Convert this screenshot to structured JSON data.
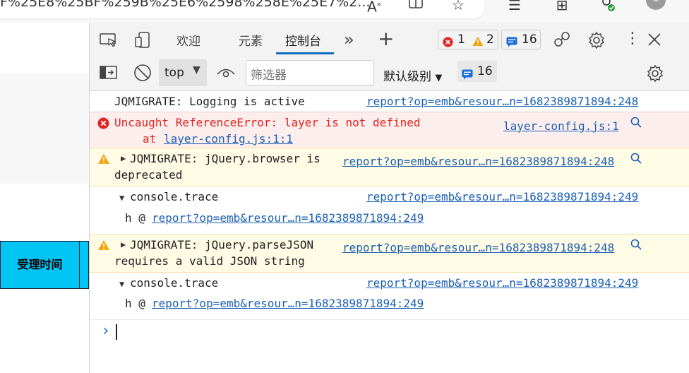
{
  "browser": {
    "url_fragment": "F%25E8%25BF%259B%25E6%2598%258E%25E7%2..."
  },
  "page": {
    "table_header": "受理时间"
  },
  "devtools": {
    "tabs": [
      "欢迎",
      "元素",
      "控制台"
    ],
    "errors_count": "1",
    "warnings_count": "2",
    "messages_count": "16",
    "toolbar": {
      "context": "top",
      "filter_placeholder": "筛选器",
      "levels": "默认级别",
      "issues_count": "16"
    },
    "console": [
      {
        "type": "log",
        "text": "JQMIGRATE: Logging is active",
        "source": "report?op=emb&resour…n=1682389871894:248"
      },
      {
        "type": "error",
        "text": "Uncaught ReferenceError: layer is not defined",
        "at": "at",
        "at_link": "layer-config.js:1:1",
        "source": "layer-config.js:1"
      },
      {
        "type": "warning",
        "text1": "JQMIGRATE: jQuery.browser is",
        "text2": "deprecated",
        "source": "report?op=emb&resour…n=1682389871894:248"
      },
      {
        "type": "trace",
        "text": "console.trace",
        "source": "report?op=emb&resour…n=1682389871894:249",
        "frame_fn": "h @",
        "frame_link": "report?op=emb&resour…n=1682389871894:249"
      },
      {
        "type": "warning",
        "text1": "JQMIGRATE: jQuery.parseJSON",
        "text2": "requires a valid JSON string",
        "source": "report?op=emb&resour…n=1682389871894:248"
      },
      {
        "type": "trace",
        "text": "console.trace",
        "source": "report?op=emb&resour…n=1682389871894:249",
        "frame_fn": "h @",
        "frame_link": "report?op=emb&resour…n=1682389871894:249"
      }
    ],
    "prompt_glyph": "›"
  },
  "colors": {
    "accent": "#0f6cbd",
    "error": "#e0241f",
    "warning": "#f0a30a",
    "table_header_bg": "#00c5f5"
  }
}
